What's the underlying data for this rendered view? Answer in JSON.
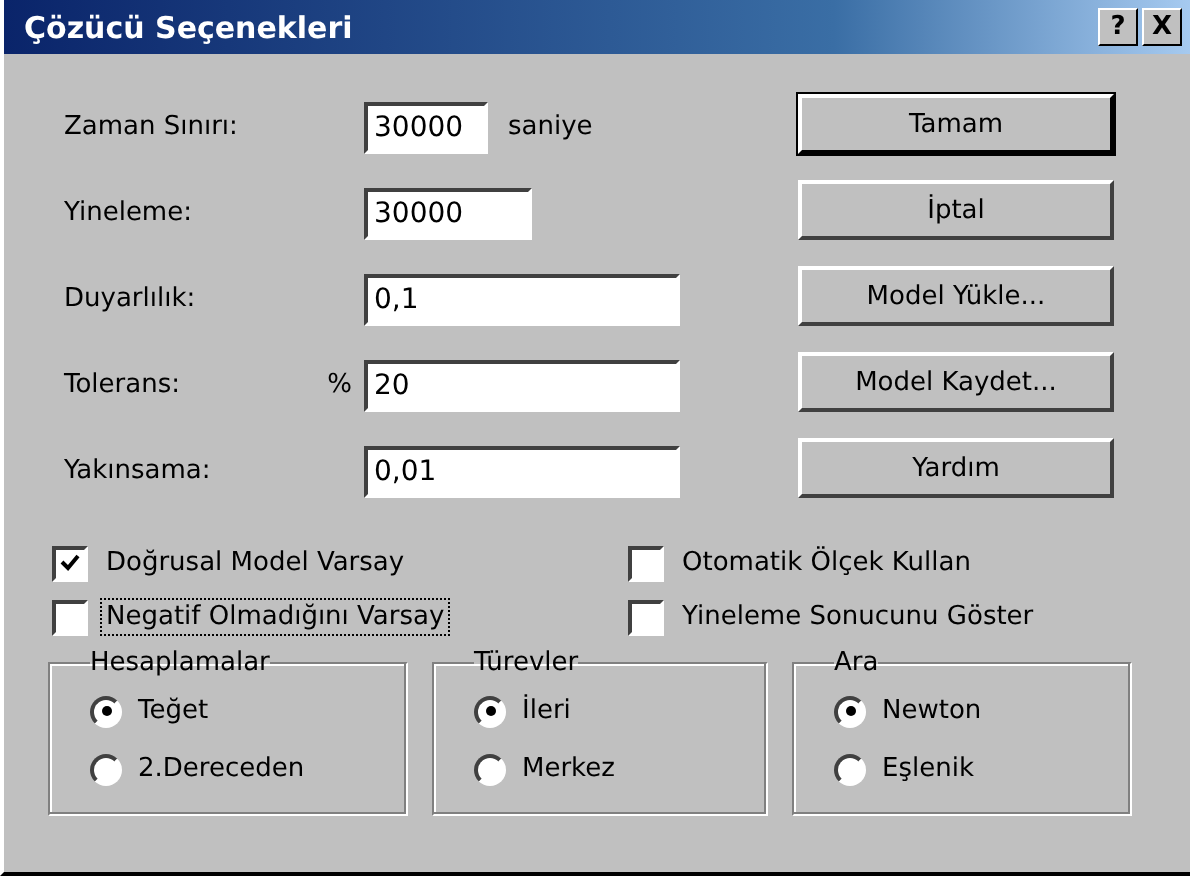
{
  "window": {
    "title": "Çözücü Seçenekleri",
    "title_buttons": [
      "?",
      "X"
    ]
  },
  "fields": [
    {
      "label": "Zaman Sınırı:",
      "value": "30000",
      "kind": "short",
      "suffix": "saniye"
    },
    {
      "label": "Yineleme:",
      "value": "30000",
      "kind": "medium"
    },
    {
      "label": "Duyarlılık:",
      "value": "0,1",
      "kind": "long"
    },
    {
      "label": "Tolerans:",
      "value": "20",
      "kind": "long",
      "prefix": "%"
    },
    {
      "label": "Yakınsama:",
      "value": "0,01",
      "kind": "long"
    }
  ],
  "buttons": [
    {
      "label": "Tamam",
      "default": true
    },
    {
      "label": "İptal",
      "default": false
    },
    {
      "label": "Model Yükle...",
      "default": false
    },
    {
      "label": "Model Kaydet...",
      "default": false
    },
    {
      "label": "Yardım",
      "default": false
    }
  ],
  "checkboxes": [
    {
      "label": "Doğrusal Model Varsay",
      "checked": true,
      "focused": false
    },
    {
      "label": "Otomatik Ölçek Kullan",
      "checked": false,
      "focused": false
    },
    {
      "label": "Negatif Olmadığını Varsay",
      "checked": false,
      "focused": true
    },
    {
      "label": "Yineleme Sonucunu Göster",
      "checked": false,
      "focused": false
    }
  ],
  "groups": [
    {
      "title": "Hesaplamalar",
      "options": [
        {
          "label": "Teğet",
          "selected": true
        },
        {
          "label": "2.Dereceden",
          "selected": false
        }
      ]
    },
    {
      "title": "Türevler",
      "options": [
        {
          "label": "İleri",
          "selected": true
        },
        {
          "label": "Merkez",
          "selected": false
        }
      ]
    },
    {
      "title": "Ara",
      "options": [
        {
          "label": "Newton",
          "selected": true
        },
        {
          "label": "Eşlenik",
          "selected": false
        }
      ]
    }
  ]
}
